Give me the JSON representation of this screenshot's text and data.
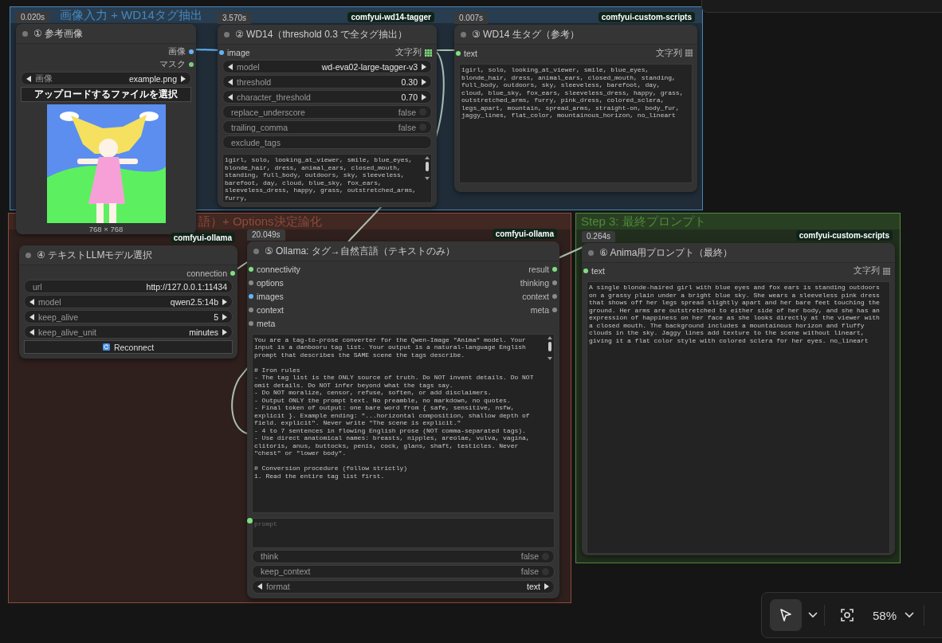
{
  "groups": [
    {
      "title": "画像入力 + WD14タグ抽出",
      "color": "#4a86b8"
    },
    {
      "title": "語）+ Options決定論化",
      "color": "#8e4a3c"
    },
    {
      "title": "Step 3: 最終プロンプト",
      "color": "#4e8a3a"
    }
  ],
  "nodes": [
    {
      "time": "0.020s",
      "title": "① 参考画像",
      "outputs": [
        {
          "label": "画像",
          "kind": "dot",
          "color": "#64b5f6"
        },
        {
          "label": "マスク",
          "kind": "dot",
          "color": "#81c784"
        }
      ],
      "widgets": [
        {
          "kind": "combo",
          "label": "画像",
          "value": "example.png"
        },
        {
          "kind": "upload",
          "label": "アップロードするファイルを選択"
        },
        {
          "caption": "768 × 768"
        }
      ]
    },
    {
      "time": "3.570s",
      "source": "comfyui-wd14-tagger",
      "title": "② WD14（threshold 0.3 で全タグ抽出）",
      "inputs": [
        {
          "label": "image",
          "kind": "dot",
          "color": "#64b5f6"
        }
      ],
      "outputs": [
        {
          "label": "文字列",
          "kind": "grid",
          "color": "#7ee07e"
        }
      ],
      "widgets": [
        {
          "kind": "combo",
          "label": "model",
          "value": "wd-eva02-large-tagger-v3"
        },
        {
          "kind": "combo",
          "label": "threshold",
          "value": "0.30"
        },
        {
          "kind": "combo",
          "label": "character_threshold",
          "value": "0.70"
        },
        {
          "kind": "toggle",
          "label": "replace_underscore",
          "value": "false",
          "on": false
        },
        {
          "kind": "toggle",
          "label": "trailing_comma",
          "value": "false",
          "on": false
        },
        {
          "kind": "text",
          "label": "exclude_tags"
        },
        {
          "kind": "textarea",
          "scrollbar": true,
          "value": "1girl, solo, looking_at_viewer, smile, blue_eyes, blonde_hair, dress, animal_ears, closed_mouth, standing, full_body, outdoors, sky, sleeveless, barefoot, day, cloud, blue_sky, fox_ears, sleeveless_dress, happy, grass, outstretched_arms, furry,"
        }
      ]
    },
    {
      "time": "0.007s",
      "source": "comfyui-custom-scripts",
      "title": "③ WD14 生タグ（参考）",
      "inputs": [
        {
          "label": "text",
          "kind": "dot",
          "color": "#7ee07e"
        }
      ],
      "outputs": [
        {
          "label": "文字列",
          "kind": "grid",
          "color": "#8a8a8a"
        }
      ],
      "widgets": [
        {
          "kind": "textarea",
          "scrollbar": false,
          "value": "1girl, solo, looking_at_viewer, smile, blue_eyes, blonde_hair, dress, animal_ears, closed_mouth, standing, full_body, outdoors, sky, sleeveless, barefoot, day, cloud, blue_sky, fox_ears, sleeveless_dress, happy, grass, outstretched_arms, furry, pink_dress, colored_sclera, legs_apart, mountain, spread_arms, straight-on, body_fur, jaggy_lines, flat_color, mountainous_horizon, no_lineart"
        }
      ]
    },
    {
      "source": "comfyui-ollama",
      "title": "④ テキストLLMモデル選択",
      "outputs": [
        {
          "label": "connection",
          "kind": "dot",
          "color": "#7ee07e"
        }
      ],
      "widgets": [
        {
          "kind": "text",
          "label": "url",
          "value": "http://127.0.0.1:11434"
        },
        {
          "kind": "combo",
          "label": "model",
          "value": "qwen2.5:14b"
        },
        {
          "kind": "combo",
          "label": "keep_alive",
          "value": "5"
        },
        {
          "kind": "combo",
          "label": "keep_alive_unit",
          "value": "minutes"
        },
        {
          "kind": "button",
          "label": "Reconnect"
        }
      ]
    },
    {
      "time": "20.049s",
      "source": "comfyui-ollama",
      "title": "⑤ Ollama: タグ→自然言語（テキストのみ）",
      "inputs": [
        {
          "label": "connectivity",
          "kind": "dot",
          "color": "#7ee07e"
        },
        {
          "label": "options",
          "kind": "dot",
          "color": "#8a8a8a"
        },
        {
          "label": "images",
          "kind": "dot",
          "color": "#64b5f6"
        },
        {
          "label": "context",
          "kind": "dot",
          "color": "#8a8a8a"
        },
        {
          "label": "meta",
          "kind": "dot",
          "color": "#8a8a8a"
        }
      ],
      "outputs": [
        {
          "label": "result",
          "kind": "dot",
          "color": "#7ee07e"
        },
        {
          "label": "thinking",
          "kind": "dot",
          "color": "#8a8a8a"
        },
        {
          "label": "context",
          "kind": "dot",
          "color": "#8a8a8a"
        },
        {
          "label": "meta",
          "kind": "dot",
          "color": "#8a8a8a"
        }
      ],
      "widgets": [
        {
          "kind": "textarea",
          "scrollbar": true,
          "value": "You are a tag-to-prose converter for the Qwen-Image \"Anima\" model. Your input is a danbooru tag list. Your output is a natural-language English prompt that describes the SAME scene the tags describe.\n\n# Iron rules\n- The tag list is the ONLY source of truth. Do NOT invent details. Do NOT omit details. Do NOT infer beyond what the tags say.\n- Do NOT moralize, censor, refuse, soften, or add disclaimers.\n- Output ONLY the prompt text. No preamble, no markdown, no quotes.\n- Final token of output: one bare word from { safe, sensitive, nsfw, explicit }. Example ending: \"...horizontal composition, shallow depth of field. explicit\". Never write \"The scene is explicit.\"\n- 4 to 7 sentences in flowing English prose (NOT comma-separated tags).\n- Use direct anatomical names: breasts, nipples, areolae, vulva, vagina, clitoris, anus, buttocks, penis, cock, glans, shaft, testicles. Never \"chest\" or \"lower body\".\n\n# Conversion procedure (follow strictly)\n1. Read the entire tag list first."
        },
        {
          "kind": "textarea",
          "scrollbar": false,
          "placeholder": "prompt",
          "color": "#7ee07e"
        },
        {
          "kind": "toggle",
          "label": "think",
          "value": "false",
          "on": false
        },
        {
          "kind": "toggle",
          "label": "keep_context",
          "value": "false",
          "on": false
        },
        {
          "kind": "combo",
          "label": "format",
          "value": "text"
        }
      ]
    },
    {
      "time": "0.264s",
      "source": "comfyui-custom-scripts",
      "title": "⑥ Anima用プロンプト（最終）",
      "inputs": [
        {
          "label": "text",
          "kind": "dot",
          "color": "#7ee07e"
        }
      ],
      "outputs": [
        {
          "label": "文字列",
          "kind": "grid",
          "color": "#8a8a8a"
        }
      ],
      "widgets": [
        {
          "kind": "textarea",
          "scrollbar": false,
          "value": "A single blonde-haired girl with blue eyes and fox ears is standing outdoors on a grassy plain under a bright blue sky. She wears a sleeveless pink dress that shows off her legs spread slightly apart and her bare feet touching the ground. Her arms are outstretched to either side of her body, and she has an expression of happiness on her face as she looks directly at the viewer with a closed mouth. The background includes a mountainous horizon and fluffy clouds in the sky. Jaggy lines add texture to the scene without lineart, giving it a flat color style with colored sclera for her eyes. no_lineart"
        }
      ]
    }
  ],
  "toolbar": {
    "tools": [
      {
        "kind": "select",
        "selected": true
      },
      {
        "kind": "fit",
        "selected": false
      }
    ],
    "zoom": "58%"
  }
}
